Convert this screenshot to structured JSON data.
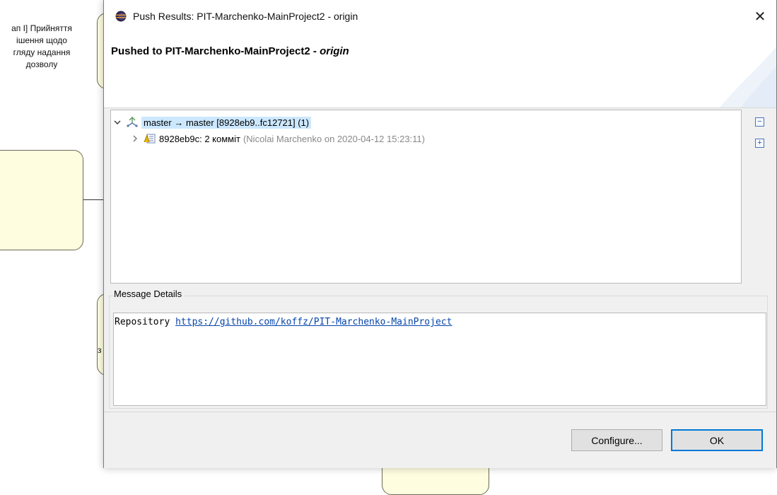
{
  "background": {
    "node2_lines": [
      "ап I] Прийняття",
      "ішення щодо",
      "гляду надання",
      "дозволу"
    ],
    "node3_text": "з"
  },
  "dialog": {
    "title": "Push Results: PIT-Marchenko-MainProject2 - origin",
    "close_glyph": "✕",
    "header": {
      "prefix": "Pushed to PIT-Marchenko-MainProject2 - ",
      "origin": "origin"
    },
    "tree": {
      "ref_row": {
        "label": "master → master [8928eb9..fc12721] (1)",
        "icon": "push-ref-icon",
        "expanded": true
      },
      "commit_row": {
        "label": "8928eb9c: 2 комміт",
        "detail": "(Nicolai Marchenko on 2020-04-12 15:23:11)",
        "icon": "commit-icon",
        "expanded": false
      }
    },
    "side_buttons": {
      "collapse_glyph": "−",
      "expand_glyph": "+"
    },
    "message_details": {
      "label": "Message Details",
      "prefix": "Repository ",
      "link": "https://github.com/koffz/PIT-Marchenko-MainProject"
    },
    "buttons": {
      "configure": "Configure...",
      "ok": "OK"
    }
  },
  "colors": {
    "accent": "#0078d7",
    "selection": "#cce8ff",
    "link": "#0645ad",
    "node_fill": "#fffde0"
  }
}
